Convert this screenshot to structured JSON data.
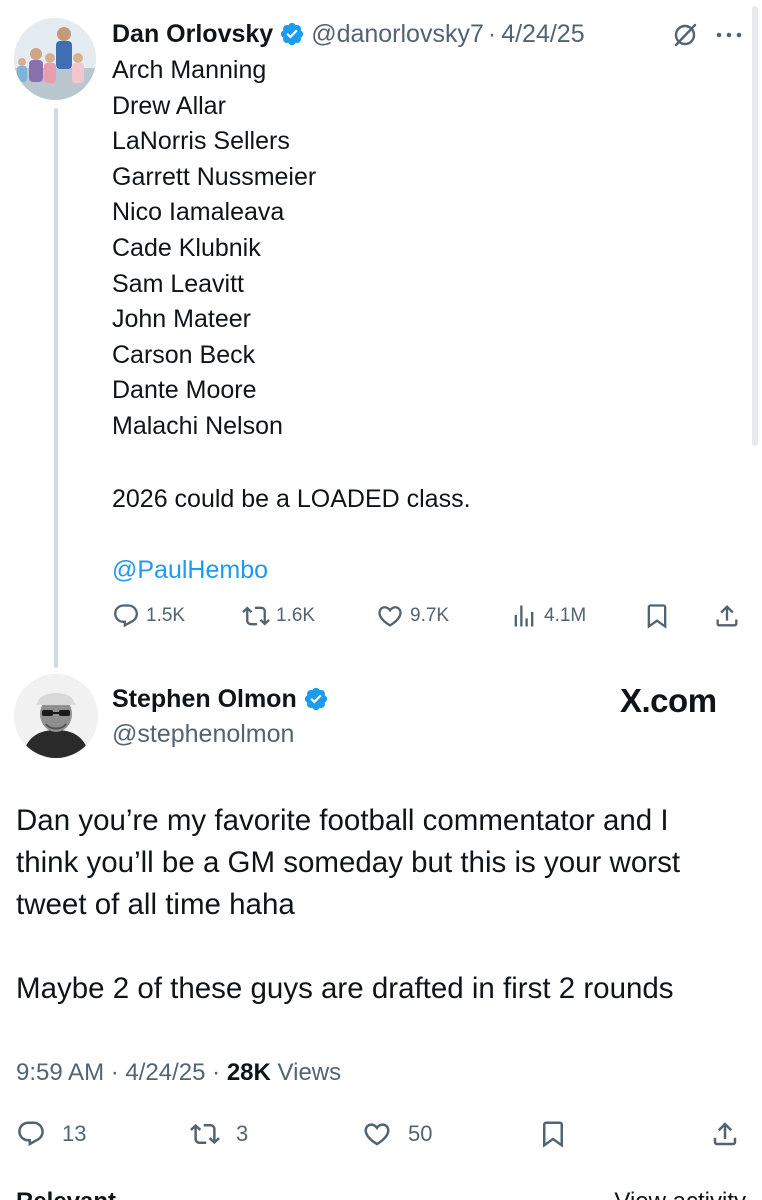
{
  "parent_tweet": {
    "author_name": "Dan Orlovsky",
    "handle": "@danorlovsky7",
    "separator": "·",
    "date": "4/24/25",
    "list": [
      "Arch Manning",
      "Drew Allar",
      "LaNorris Sellers",
      "Garrett Nussmeier",
      "Nico Iamaleava",
      "Cade Klubnik",
      "Sam Leavitt",
      "John Mateer",
      "Carson Beck",
      "Dante Moore",
      "Malachi Nelson"
    ],
    "closing": "2026 could be a LOADED class.",
    "mention": "@PaulHembo",
    "actions": {
      "replies": "1.5K",
      "reposts": "1.6K",
      "likes": "9.7K",
      "views": "4.1M"
    }
  },
  "reply_tweet": {
    "author_name": "Stephen Olmon",
    "handle": "@stephenolmon",
    "brand": "X.com",
    "body_lines": [
      "Dan you’re my favorite football commentator and I",
      "think you’ll be a GM someday but this is your worst",
      "tweet of all time haha",
      "",
      "Maybe 2 of these guys are drafted in first 2 rounds"
    ],
    "meta": {
      "time": "9:59 AM",
      "separator": "·",
      "date": "4/24/25",
      "views_count": "28K",
      "views_label": "Views"
    },
    "actions": {
      "replies": "13",
      "reposts": "3",
      "likes": "50"
    }
  },
  "cutoff_row": {
    "left": "Relevant",
    "right": "View activity"
  },
  "colors": {
    "text": "#0f1419",
    "secondary": "#536471",
    "link": "#1d9bf0",
    "verified": "#1d9bf0",
    "thread_line": "#cfd9de"
  }
}
